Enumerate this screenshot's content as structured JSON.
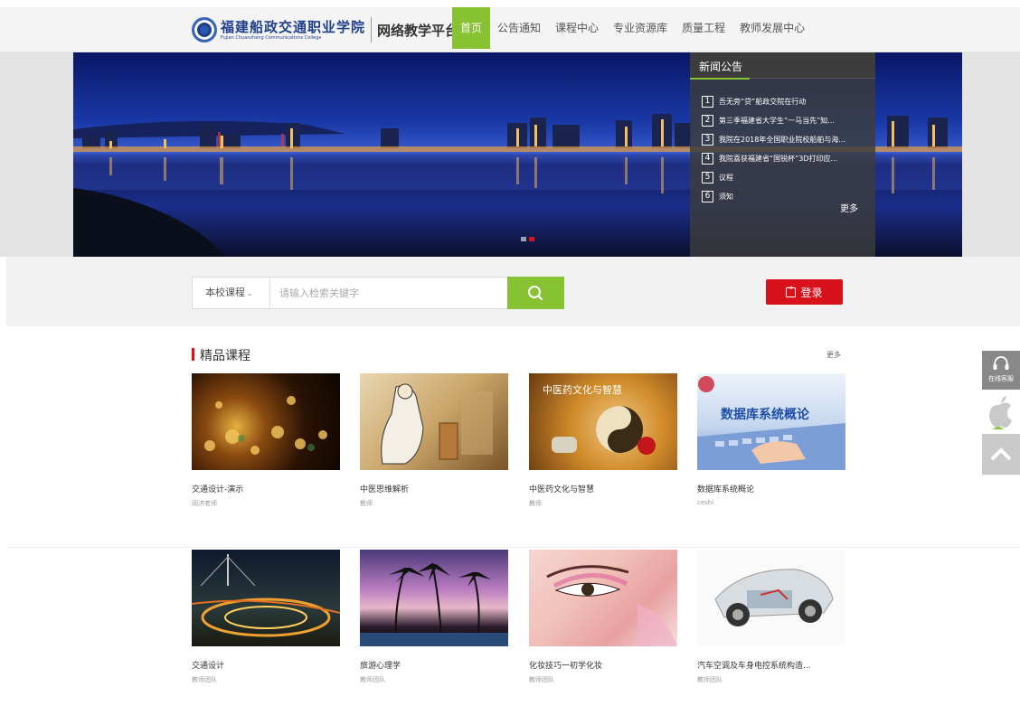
{
  "header": {
    "logo_cn": "福建船政交通职业学院",
    "logo_en": "Fujian Chuanzheng Communications College",
    "platform": "网络教学平台",
    "nav": [
      "首页",
      "公告通知",
      "课程中心",
      "专业资源库",
      "质量工程",
      "教师发展中心"
    ],
    "active_nav": "首页"
  },
  "news": {
    "title": "新闻公告",
    "items": [
      {
        "num": "1",
        "text": "吾无旁“贷”船政交院在行动"
      },
      {
        "num": "2",
        "text": "第三季福建省大学生“一马当先”知..."
      },
      {
        "num": "3",
        "text": "我院在2018年全国职业院校船舶与海..."
      },
      {
        "num": "4",
        "text": "我院喜获福建省“国锐杯”3D打印应..."
      },
      {
        "num": "5",
        "text": "议程"
      },
      {
        "num": "6",
        "text": "须知"
      }
    ],
    "more": "更多"
  },
  "search": {
    "scope": "本校课程",
    "placeholder": "请输入检索关键字"
  },
  "login": {
    "label": "登录"
  },
  "section": {
    "title": "精品课程",
    "more": "更多"
  },
  "courses": [
    {
      "title": "交通设计-演示",
      "author": "同济老师",
      "thumb_icon": "bokeh-lights-image"
    },
    {
      "title": "中医思维解析",
      "author": "教师",
      "thumb_icon": "tcm-scholar-image"
    },
    {
      "title": "中医药文化与智慧",
      "author": "教师",
      "thumb_icon": "yin-yang-herbs-image"
    },
    {
      "title": "数据库系统概论",
      "author": "ceshi",
      "thumb_text": "数据库系统概论",
      "thumb_icon": "keyboard-image"
    },
    {
      "title": "交通设计",
      "author": "教师团队",
      "thumb_icon": "highway-interchange-image"
    },
    {
      "title": "旅游心理学",
      "author": "教师团队",
      "thumb_icon": "palm-tree-sunset-image"
    },
    {
      "title": "化妆技巧一初学化妆",
      "author": "教师团队",
      "thumb_icon": "makeup-eye-image"
    },
    {
      "title": "汽车空调及车身电控系统构造...",
      "author": "教师团队",
      "thumb_icon": "car-chassis-image"
    }
  ],
  "float": {
    "service_label": "在线客服"
  },
  "colors": {
    "accent_green": "#86c232",
    "accent_red": "#d8121a"
  }
}
